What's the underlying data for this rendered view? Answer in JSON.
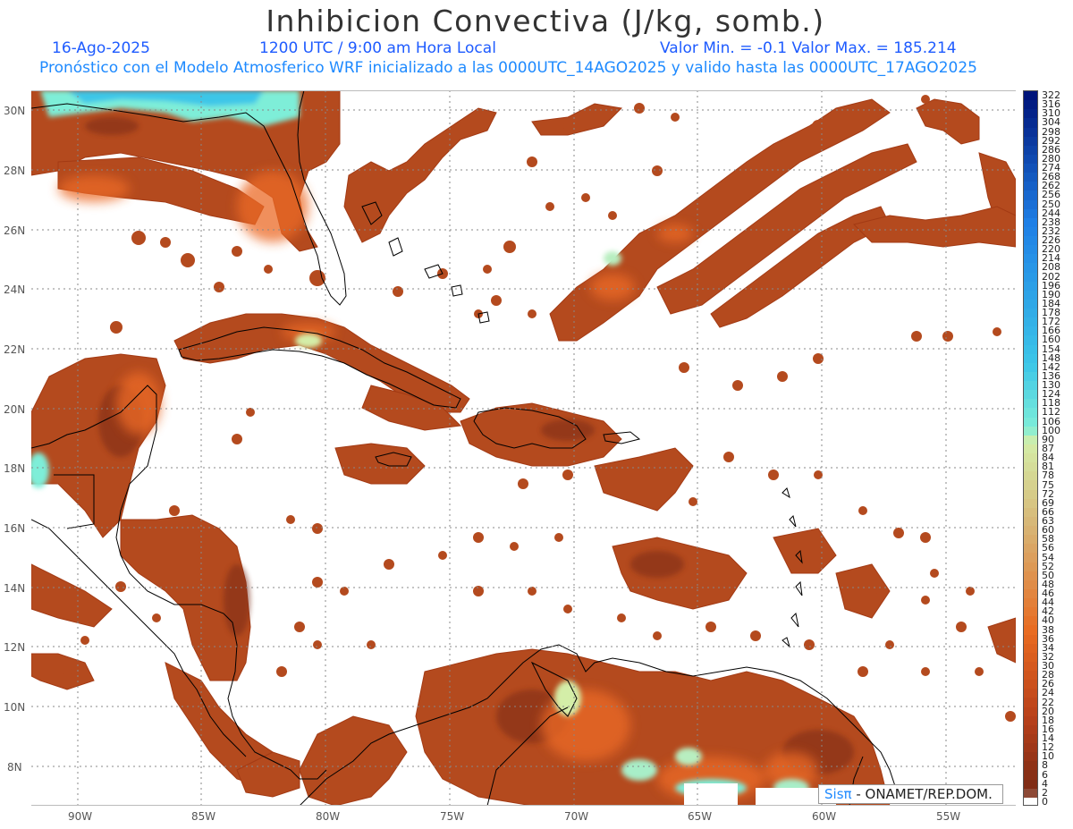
{
  "title": "Inhibicion Convectiva (J/kg, somb.)",
  "header": {
    "date": "16-Ago-2025",
    "time": "1200 UTC / 9:00 am Hora Local",
    "minmax": "Valor Min. = -0.1  Valor Max. = 185.214",
    "forecast": "Pronóstico con el Modelo Atmosferico WRF inicializado a las 0000UTC_14AGO2025 y valido hasta las  0000UTC_17AGO2025"
  },
  "axes": {
    "lat_labels": [
      "30N",
      "28N",
      "26N",
      "24N",
      "22N",
      "20N",
      "18N",
      "16N",
      "14N",
      "12N",
      "10N",
      "8N"
    ],
    "lon_labels": [
      "90W",
      "85W",
      "80W",
      "75W",
      "70W",
      "65W",
      "60W",
      "55W"
    ]
  },
  "colorbar": {
    "labels": [
      "322",
      "316",
      "310",
      "304",
      "298",
      "292",
      "286",
      "280",
      "274",
      "268",
      "262",
      "256",
      "250",
      "244",
      "238",
      "232",
      "226",
      "220",
      "214",
      "208",
      "202",
      "196",
      "190",
      "184",
      "178",
      "172",
      "166",
      "160",
      "154",
      "148",
      "142",
      "136",
      "130",
      "124",
      "118",
      "112",
      "106",
      "100",
      "90",
      "87",
      "84",
      "81",
      "78",
      "75",
      "72",
      "69",
      "66",
      "63",
      "60",
      "58",
      "56",
      "54",
      "52",
      "50",
      "48",
      "46",
      "44",
      "42",
      "40",
      "38",
      "36",
      "34",
      "32",
      "30",
      "28",
      "26",
      "24",
      "22",
      "20",
      "18",
      "16",
      "14",
      "12",
      "10",
      "8",
      "6",
      "4",
      "2",
      "0"
    ],
    "colors": {
      "dark_blue": "#00147a",
      "mid_blue": "#1e7fe6",
      "light_blue": "#3cc6e8",
      "aqua": "#7eeed8",
      "pale_green": "#d4eea8",
      "tan": "#d8b070",
      "orange": "#e86a20",
      "red_brown": "#b8401a",
      "dark_brown": "#7a2a14",
      "white": "#ffffff"
    }
  },
  "credit": {
    "sis": "Sisπ",
    "org": "- ONAMET/REP.DOM."
  }
}
